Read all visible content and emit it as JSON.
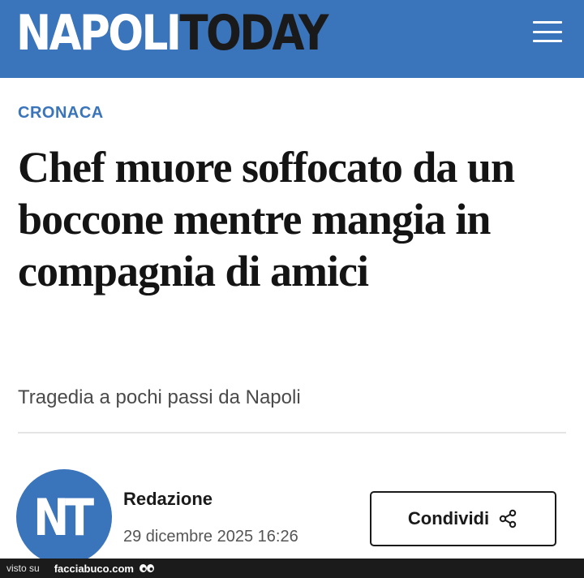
{
  "header": {
    "logo_part1": "NAPOLI",
    "logo_part2": "TODAY",
    "menu_icon": "hamburger-menu-icon",
    "background_color": "#3a74bb"
  },
  "article": {
    "category": "CRONACA",
    "headline": "Chef muore soffocato da un boccone mentre mangia in compagnia di amici",
    "subtitle": "Tragedia a pochi passi da Napoli",
    "author": {
      "avatar_initials": "NT",
      "name": "Redazione",
      "date": "29 dicembre 2025 16:26"
    },
    "share": {
      "label": "Condividi",
      "icon": "share-icon"
    }
  },
  "footer": {
    "prefix": "visto su",
    "site": "facciabuco.com",
    "icon": "eyes-icon"
  }
}
